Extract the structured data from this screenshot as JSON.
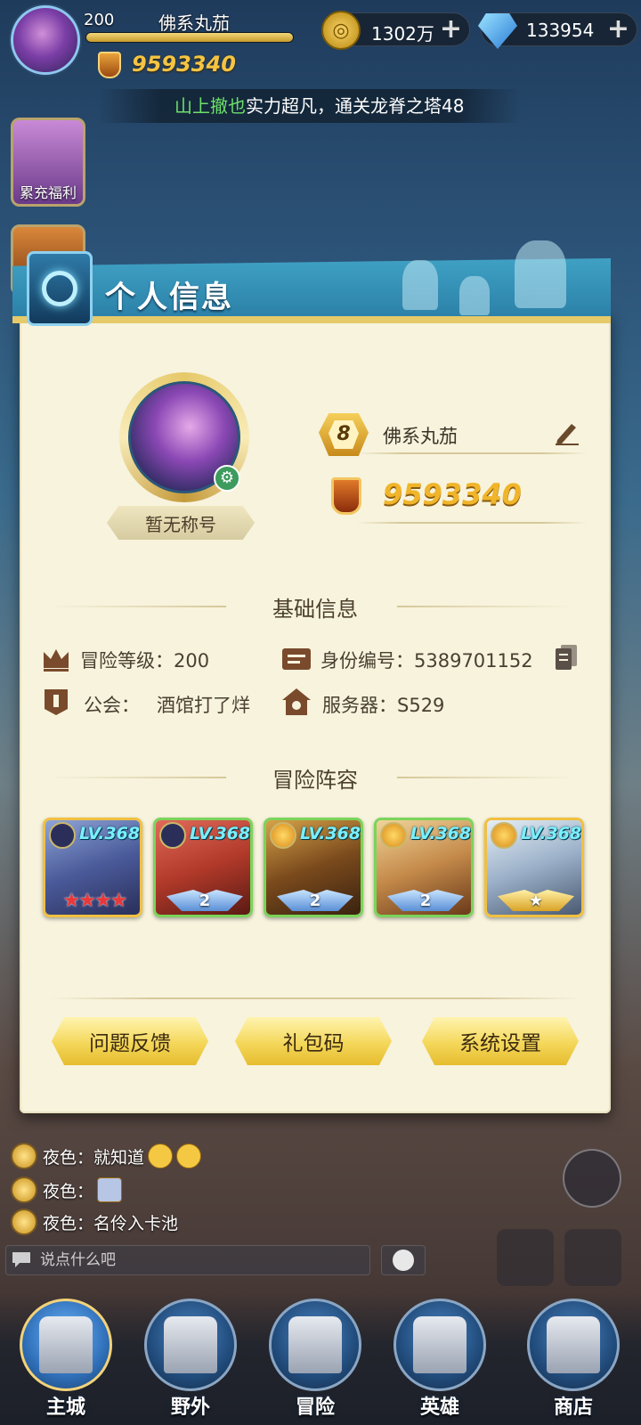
{
  "hud": {
    "level": "200",
    "player_name": "佛系丸茄",
    "power": "9593340",
    "gold": "1302万",
    "gems": "133954",
    "plus": "+"
  },
  "ticker": {
    "highlight": "山上撤也",
    "rest": "实力超凡，通关龙脊之塔48"
  },
  "side": {
    "recharge_label": "累充福利"
  },
  "panel": {
    "title": "个人信息",
    "player_title": "暂无称号",
    "level_badge": "8",
    "name": "佛系丸茄",
    "power": "9593340",
    "basic_section": "基础信息",
    "adventure_level": "冒险等级：200",
    "id_number": "身份编号：5389701152",
    "guild_label": "公会：",
    "guild_name": "酒馆打了烊",
    "server": "服务器：S529",
    "lineup_section": "冒险阵容",
    "heroes": [
      {
        "lv": "LV.368",
        "rank": "★★★★",
        "elem": "dark"
      },
      {
        "lv": "LV.368",
        "rank": "2",
        "elem": "dark"
      },
      {
        "lv": "LV.368",
        "rank": "2",
        "elem": "light"
      },
      {
        "lv": "LV.368",
        "rank": "2",
        "elem": "light"
      },
      {
        "lv": "LV.368",
        "rank": "★",
        "elem": "light"
      }
    ],
    "buttons": {
      "feedback": "问题反馈",
      "gift_code": "礼包码",
      "settings": "系统设置"
    }
  },
  "chat": {
    "lines": [
      {
        "speaker": "夜色：",
        "text": "就知道"
      },
      {
        "speaker": "夜色：",
        "text": ""
      },
      {
        "speaker": "夜色：",
        "text": "名伶入卡池"
      }
    ],
    "placeholder": "说点什么吧"
  },
  "nav": {
    "items": [
      "主城",
      "野外",
      "冒险",
      "英雄",
      "商店"
    ]
  },
  "colors": {
    "panel_bg": "#f7f3dd",
    "header_blue": "#2a7ea6",
    "gold_accent": "#f0b52a",
    "ticker_highlight": "#6ee06a"
  }
}
